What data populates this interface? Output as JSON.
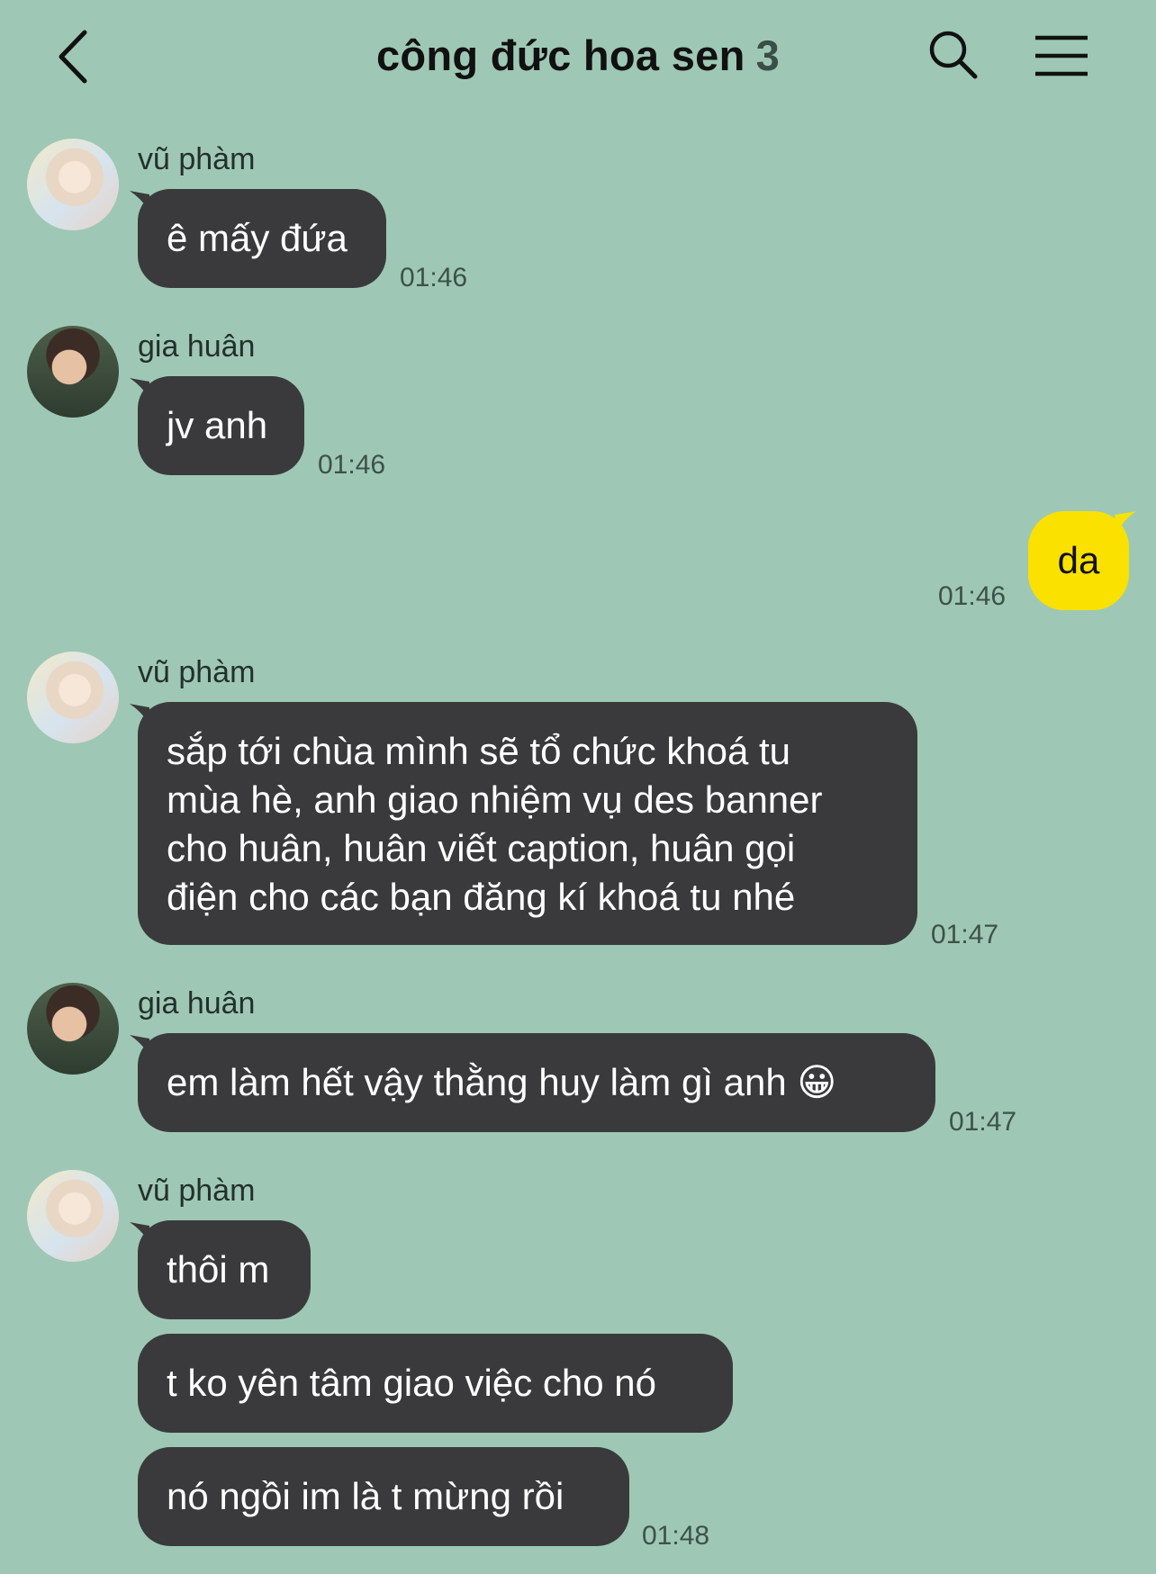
{
  "header": {
    "title": "công đức hoa sen",
    "member_count": "3"
  },
  "messages": [
    {
      "sender": "vũ phàm",
      "texts": [
        "ê mấy đứa"
      ],
      "time": "01:46"
    },
    {
      "sender": "gia huân",
      "texts": [
        "jv anh"
      ],
      "time": "01:46"
    },
    {
      "sender": "me",
      "texts": [
        "da"
      ],
      "time": "01:46"
    },
    {
      "sender": "vũ phàm",
      "lines": [
        "sắp tới chùa mình sẽ tổ chức khoá tu",
        "mùa hè, anh giao nhiệm vụ des banner",
        "cho huân, huân viết caption, huân gọi",
        "điện cho các bạn đăng kí khoá tu nhé"
      ],
      "time": "01:47"
    },
    {
      "sender": "gia huân",
      "texts": [
        "em làm hết vậy thằng huy làm gì anh 😀"
      ],
      "time": "01:47"
    },
    {
      "sender": "vũ phàm",
      "texts": [
        "thôi m",
        "t ko yên tâm giao việc cho nó",
        "nó ngồi im là t mừng rồi"
      ],
      "time": "01:48"
    }
  ],
  "icons": {
    "back": "chevron-left-icon",
    "search": "search-icon",
    "menu": "hamburger-menu-icon"
  },
  "colors": {
    "background": "#9ec8b5",
    "incoming_bubble": "#3a3a3c",
    "outgoing_bubble": "#fae100"
  }
}
